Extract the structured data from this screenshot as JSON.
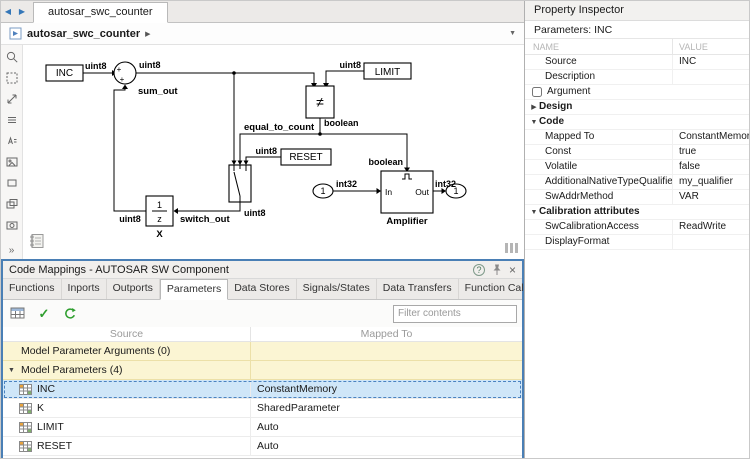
{
  "editor": {
    "tab": "autosar_swc_counter",
    "breadcrumb": "autosar_swc_counter"
  },
  "diagram": {
    "inc": "INC",
    "limit": "LIMIT",
    "reset": "RESET",
    "neq": "≠",
    "plus": "+",
    "frac_num": "1",
    "frac_den": "z",
    "sum_out": "sum_out",
    "equal_to_count": "equal_to_count",
    "switch_out": "switch_out",
    "delay_name": "X",
    "amplifier": "Amplifier",
    "in_label": "In",
    "out_label": "Out",
    "inport": "1",
    "outport": "1",
    "uint8": "uint8",
    "boolean": "boolean",
    "int32": "int32"
  },
  "mappings": {
    "title": "Code Mappings - AUTOSAR SW Component",
    "tabs": [
      {
        "label": "Functions"
      },
      {
        "label": "Inports"
      },
      {
        "label": "Outports"
      },
      {
        "label": "Parameters"
      },
      {
        "label": "Data Stores"
      },
      {
        "label": "Signals/States"
      },
      {
        "label": "Data Transfers"
      },
      {
        "label": "Function Callers"
      }
    ],
    "filter_placeholder": "Filter contents",
    "columns": {
      "source": "Source",
      "mapped_to": "Mapped To"
    },
    "group1": "Model Parameter Arguments (0)",
    "group2": "Model Parameters (4)",
    "rows": [
      {
        "source": "INC",
        "mapped_to": "ConstantMemory"
      },
      {
        "source": "K",
        "mapped_to": "SharedParameter"
      },
      {
        "source": "LIMIT",
        "mapped_to": "Auto"
      },
      {
        "source": "RESET",
        "mapped_to": "Auto"
      }
    ]
  },
  "inspector": {
    "title": "Property Inspector",
    "context": "Parameters: INC",
    "name_col": "NAME",
    "value_col": "VALUE",
    "rows": [
      {
        "name": "Source",
        "value": "INC"
      },
      {
        "name": "Description",
        "value": ""
      },
      {
        "name": "Argument",
        "value": ""
      },
      {
        "name": "Design",
        "value": ""
      },
      {
        "name": "Code",
        "value": ""
      },
      {
        "name": "Mapped To",
        "value": "ConstantMemory"
      },
      {
        "name": "Const",
        "value": "true"
      },
      {
        "name": "Volatile",
        "value": "false"
      },
      {
        "name": "AdditionalNativeTypeQualifier",
        "value": "my_qualifier"
      },
      {
        "name": "SwAddrMethod",
        "value": "VAR"
      },
      {
        "name": "Calibration attributes",
        "value": ""
      },
      {
        "name": "SwCalibrationAccess",
        "value": "ReadWrite"
      },
      {
        "name": "DisplayFormat",
        "value": ""
      }
    ]
  }
}
